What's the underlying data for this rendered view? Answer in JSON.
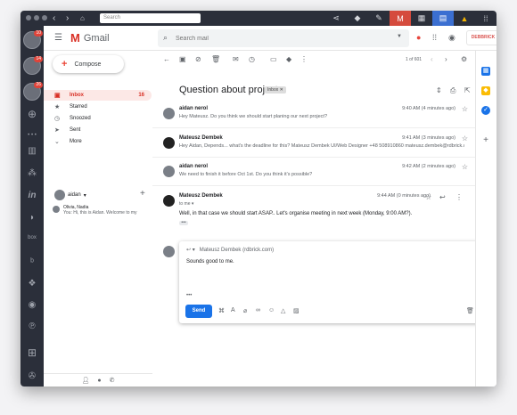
{
  "browser": {
    "search_placeholder": "Search"
  },
  "apps": {
    "badges": [
      "10",
      "14",
      "26"
    ]
  },
  "header": {
    "logo_text": "Gmail",
    "search_placeholder": "Search mail",
    "brand": "DEBBRICK"
  },
  "nav": {
    "compose": "Compose",
    "items": [
      {
        "label": "Inbox",
        "icon": "inbox-icon",
        "count": "16"
      },
      {
        "label": "Starred",
        "icon": "star-icon"
      },
      {
        "label": "Snoozed",
        "icon": "clock-icon"
      },
      {
        "label": "Sent",
        "icon": "send-icon"
      },
      {
        "label": "More",
        "icon": "chevron-down-icon"
      }
    ],
    "hangouts_user": "aidan",
    "chat": {
      "name": "Olivia, Nadia",
      "message": "You: Hi, this is Aidan. Welcome to my"
    }
  },
  "thread": {
    "pager": "1 of 601",
    "subject": "Question about project",
    "label": "Inbox",
    "messages": [
      {
        "from": "aidan nerol",
        "time": "9:40 AM (4 minutes ago)",
        "snippet": "Hey Mateusz. Do you think we should start planing our next project?"
      },
      {
        "from": "Mateusz Dembek",
        "time": "9:41 AM (3 minutes ago)",
        "snippet": "Hey Aidan, Depends... what's the deadline for this? Mateusz Dembek UI/Web Designer +48 508910860 mateusz.dembek@rdbrick.com rdbrick.com"
      },
      {
        "from": "aidan nerol",
        "time": "9:42 AM (2 minutes ago)",
        "snippet": "We need to finish it before Oct 1st. Do you think it's possible?"
      }
    ],
    "expanded": {
      "from": "Mateusz Dembek",
      "to": "to me",
      "time": "9:44 AM (0 minutes ago)",
      "body": "Well, in that case we should start ASAP.. Let's organise meeting in next week (Monday, 9:00 AM?)."
    }
  },
  "reply": {
    "recipient": "Mateusz Dembek (rdbrick.com)",
    "body": "Sounds good to me.",
    "send": "Send"
  },
  "colors": {
    "accent": "#1a73e8",
    "gmail_red": "#d93025",
    "chrome": "#2b2f3a"
  }
}
